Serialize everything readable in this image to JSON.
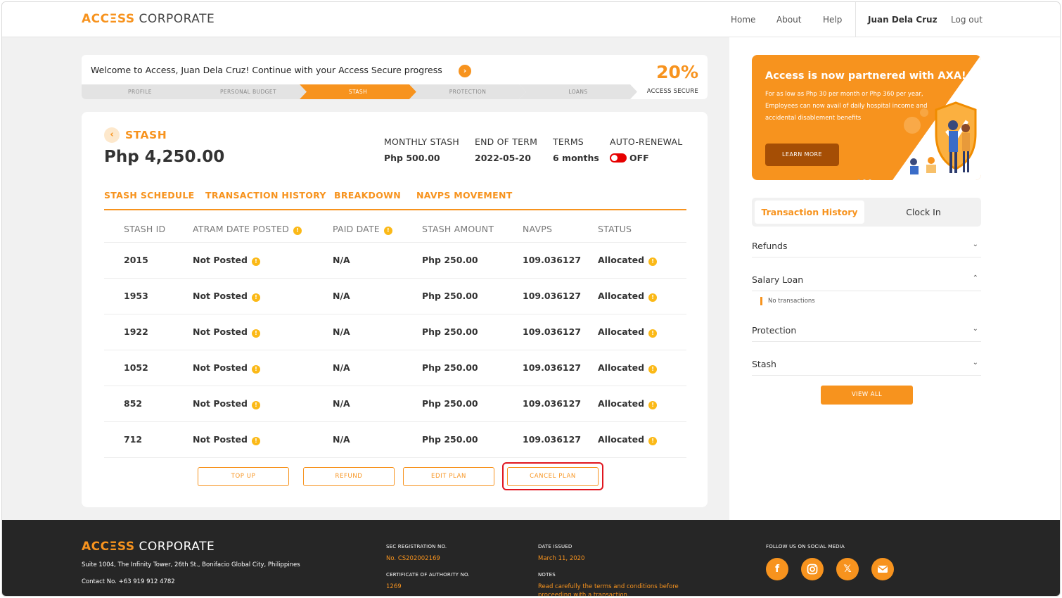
{
  "header": {
    "logo_part1": "ACCΞSS",
    "logo_part2": " CORPORATE",
    "nav": [
      "Home",
      "About",
      "Help"
    ],
    "user_name": "Juan Dela Cruz",
    "logout": "Log out"
  },
  "progress": {
    "welcome": "Welcome to Access, Juan Dela Cruz! Continue with your Access Secure progress",
    "percent": "20%",
    "percent_label": "ACCESS SECURE",
    "steps": [
      "PROFILE",
      "PERSONAL BUDGET",
      "STASH",
      "PROTECTION",
      "LOANS"
    ],
    "active_step": "STASH"
  },
  "stash": {
    "title": "STASH",
    "amount": "Php 4,250.00",
    "meta": [
      {
        "label": "MONTHLY STASH",
        "value": "Php 500.00"
      },
      {
        "label": "END OF TERM",
        "value": "2022-05-20"
      },
      {
        "label": "TERMS",
        "value": "6 months"
      },
      {
        "label": "AUTO-RENEWAL",
        "value": "OFF"
      }
    ],
    "tabs": [
      "STASH SCHEDULE",
      "TRANSACTION HISTORY",
      "BREAKDOWN",
      "NAVPS MOVEMENT"
    ],
    "columns": [
      "STASH ID",
      "ATRAM DATE POSTED",
      "PAID DATE",
      "STASH AMOUNT",
      "NAVPS",
      "STATUS"
    ],
    "rows": [
      {
        "id": "2015",
        "posted": "Not Posted",
        "paid": "N/A",
        "amount": "Php 250.00",
        "navps": "109.036127",
        "status": "Allocated"
      },
      {
        "id": "1953",
        "posted": "Not Posted",
        "paid": "N/A",
        "amount": "Php 250.00",
        "navps": "109.036127",
        "status": "Allocated"
      },
      {
        "id": "1922",
        "posted": "Not Posted",
        "paid": "N/A",
        "amount": "Php 250.00",
        "navps": "109.036127",
        "status": "Allocated"
      },
      {
        "id": "1052",
        "posted": "Not Posted",
        "paid": "N/A",
        "amount": "Php 250.00",
        "navps": "109.036127",
        "status": "Allocated"
      },
      {
        "id": "852",
        "posted": "Not Posted",
        "paid": "N/A",
        "amount": "Php 250.00",
        "navps": "109.036127",
        "status": "Allocated"
      },
      {
        "id": "712",
        "posted": "Not Posted",
        "paid": "N/A",
        "amount": "Php 250.00",
        "navps": "109.036127",
        "status": "Allocated"
      }
    ],
    "actions": [
      "TOP UP",
      "REFUND",
      "EDIT PLAN",
      "CANCEL PLAN"
    ]
  },
  "promo": {
    "title": "Access is now partnered with AXA!",
    "text": "For as low as Php 30 per month or Php 360 per year, Employees can now avail of daily hospital income and accidental disablement benefits",
    "button": "LEARN MORE"
  },
  "sidebar": {
    "switch": [
      "Transaction History",
      "Clock In"
    ],
    "sections": [
      {
        "label": "Refunds",
        "chevron": "⌄"
      },
      {
        "label": "Salary Loan",
        "chevron": "⌃"
      },
      {
        "label": "Protection",
        "chevron": "⌄"
      },
      {
        "label": "Stash",
        "chevron": "⌄"
      }
    ],
    "no_transactions": "No transactions",
    "view_all": "VIEW ALL"
  },
  "footer": {
    "logo_part1": "ACCΞSS",
    "logo_part2": " CORPORATE",
    "address": "Suite 1004, The Infinity Tower, 26th St., Bonifacio Global City, Philippines",
    "contact": "Contact No. +63 919 912 4782",
    "sec_label": "SEC REGISTRATION NO.",
    "sec_value": "No. CS202002169",
    "cert_label": "CERTIFICATE OF AUTHORITY NO.",
    "cert_value": "1269",
    "date_label": "DATE ISSUED",
    "date_value": "March 11, 2020",
    "notes_label": "NOTES",
    "notes_value": "Read carefully the terms and conditions before proceeding with a transaction.",
    "follow_label": "FOLLOW US ON SOCIAL MEDIA",
    "social_icons": [
      "facebook-icon",
      "instagram-icon",
      "x-icon",
      "email-icon"
    ]
  },
  "colors": {
    "accent": "#f7931e",
    "danger": "#e0161f",
    "footer_bg": "#262626"
  }
}
